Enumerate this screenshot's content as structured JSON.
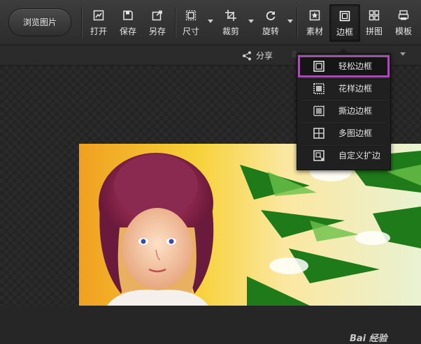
{
  "toolbar": {
    "browse_label": "浏览图片",
    "tools": [
      {
        "label": "打开",
        "icon": "open-icon"
      },
      {
        "label": "保存",
        "icon": "save-icon"
      },
      {
        "label": "另存",
        "icon": "save-as-icon"
      },
      {
        "label": "尺寸",
        "icon": "resize-icon"
      },
      {
        "label": "裁剪",
        "icon": "crop-icon"
      },
      {
        "label": "旋转",
        "icon": "rotate-icon"
      },
      {
        "label": "素材",
        "icon": "material-icon"
      },
      {
        "label": "边框",
        "icon": "border-icon",
        "active": true
      },
      {
        "label": "拼图",
        "icon": "collage-icon"
      },
      {
        "label": "模板",
        "icon": "template-icon"
      }
    ]
  },
  "subbar": {
    "share_label": "分享"
  },
  "border_menu": {
    "items": [
      {
        "label": "轻松边框",
        "icon": "simple-border-icon",
        "highlighted": true
      },
      {
        "label": "花样边框",
        "icon": "pattern-border-icon"
      },
      {
        "label": "撕边边框",
        "icon": "torn-border-icon"
      },
      {
        "label": "多图边框",
        "icon": "multi-image-border-icon"
      },
      {
        "label": "自定义扩边",
        "icon": "custom-extend-icon"
      }
    ]
  },
  "watermark": "Bai 经验",
  "colors": {
    "highlight_outline": "#a24fae",
    "toolbar_bg": "#333333",
    "menu_bg": "#202020"
  }
}
